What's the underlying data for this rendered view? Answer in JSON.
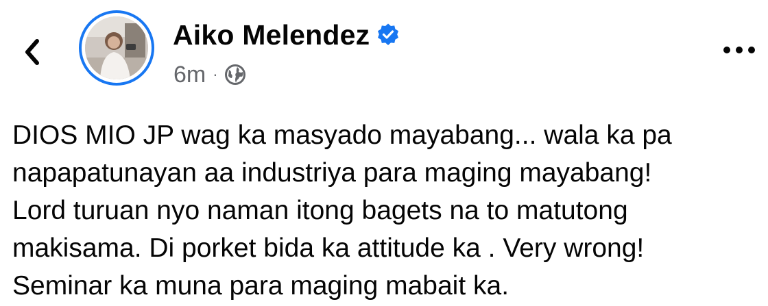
{
  "header": {
    "back_icon": "chevron-left-icon",
    "author_name": "Aiko Melendez",
    "verified_icon": "verified-badge-icon",
    "timestamp": "6m",
    "separator": "·",
    "audience_icon": "globe-icon",
    "more_icon": "more-horizontal-icon"
  },
  "post": {
    "lines": [
      "DIOS MIO JP wag ka masyado mayabang... wala ka pa",
      "napapatunayan aa industriya para maging mayabang!",
      "Lord turuan nyo naman itong bagets na to matutong",
      "makisama. Di porket bida ka attitude ka . Very wrong!",
      "Seminar ka muna para maging mabait ka."
    ]
  },
  "colors": {
    "accent": "#1877f2",
    "text": "#050505",
    "secondary_text": "#65676b"
  }
}
